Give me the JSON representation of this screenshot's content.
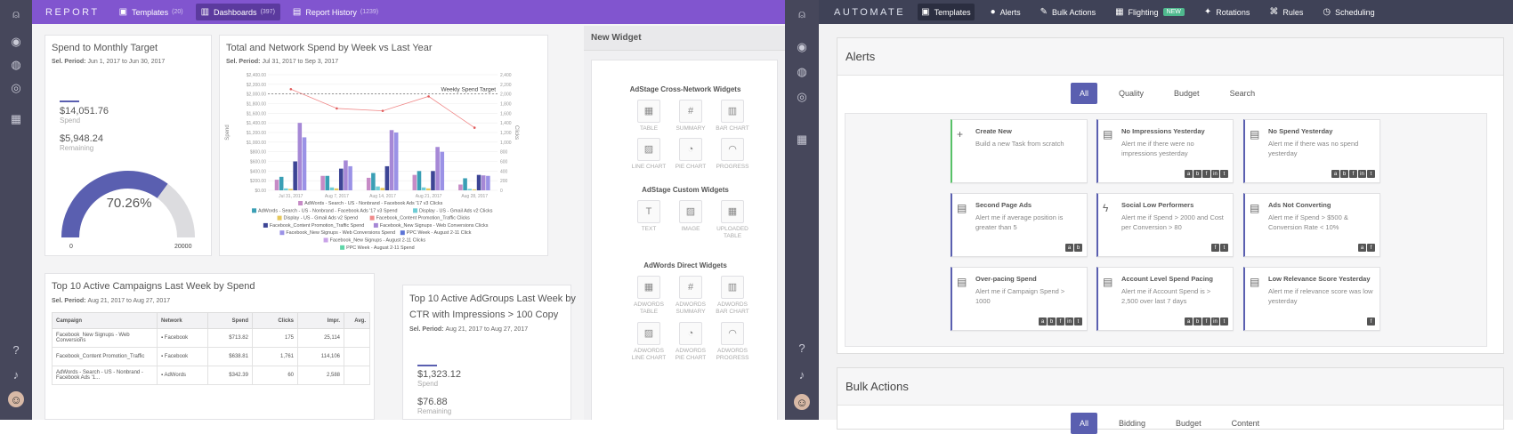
{
  "left": {
    "brand": "REPORT",
    "nav": [
      {
        "label": "Templates",
        "count": "(20)",
        "icon": "▣"
      },
      {
        "label": "Dashboards",
        "count": "(397)",
        "icon": "▥"
      },
      {
        "label": "Report History",
        "count": "(1239)",
        "icon": "▤"
      }
    ],
    "spend_card": {
      "title": "Spend to Monthly Target",
      "sel_label": "Sel. Period:",
      "sel_value": "Jun 1, 2017 to Jun 30, 2017",
      "spend_value": "$14,051.76",
      "spend_label": "Spend",
      "remaining_value": "$5,948.24",
      "remaining_label": "Remaining",
      "percent": "70.26%",
      "percent_value": 70.26,
      "min": "0",
      "max": "20000"
    },
    "network_card": {
      "title": "Total and Network Spend by Week vs Last Year",
      "sel_label": "Sel. Period:",
      "sel_value": "Jul 31, 2017 to Sep 3, 2017"
    },
    "campaigns_card": {
      "title": "Top 10 Active Campaigns Last Week by Spend",
      "sel_label": "Sel. Period:",
      "sel_value": "Aug 21, 2017 to Aug 27, 2017",
      "columns": [
        "Campaign",
        "Network",
        "Spend",
        "Clicks",
        "Impr.",
        "Avg."
      ],
      "rows": [
        {
          "campaign": "Facebook_New Signups - Web Conversions",
          "network": "Facebook",
          "spend": "$713.82",
          "clicks": "175",
          "impr": "25,114",
          "avg": ""
        },
        {
          "campaign": "Facebook_Content Promotion_Traffic",
          "network": "Facebook",
          "spend": "$638.81",
          "clicks": "1,761",
          "impr": "114,106",
          "avg": ""
        },
        {
          "campaign": "AdWords - Search - US - Nonbrand - Facebook Ads '1...",
          "network": "AdWords",
          "spend": "$342.39",
          "clicks": "60",
          "impr": "2,588",
          "avg": ""
        }
      ]
    },
    "adgroups_card": {
      "title_line1": "Top 10 Active AdGroups Last Week by",
      "title_line2": "CTR with Impressions > 100 Copy",
      "sel_label": "Sel. Period:",
      "sel_value": "Aug 21, 2017 to Aug 27, 2017",
      "spend_value": "$1,323.12",
      "spend_label": "Spend",
      "remaining_value": "$76.88",
      "remaining_label": "Remaining"
    },
    "new_widget": {
      "header": "New Widget",
      "sections": [
        {
          "title": "AdStage Cross-Network Widgets",
          "items": [
            {
              "label": "TABLE",
              "icon": "▦"
            },
            {
              "label": "SUMMARY",
              "icon": "#"
            },
            {
              "label": "BAR CHART",
              "icon": "▥"
            },
            {
              "label": "LINE CHART",
              "icon": "▨"
            },
            {
              "label": "PIE CHART",
              "icon": "◔"
            },
            {
              "label": "PROGRESS",
              "icon": "◠"
            }
          ]
        },
        {
          "title": "AdStage Custom Widgets",
          "items": [
            {
              "label": "TEXT",
              "icon": "T"
            },
            {
              "label": "IMAGE",
              "icon": "▨"
            },
            {
              "label": "UPLOADED TABLE",
              "icon": "▦"
            }
          ]
        },
        {
          "title": "AdWords Direct Widgets",
          "items": [
            {
              "label": "ADWORDS TABLE",
              "icon": "▦"
            },
            {
              "label": "ADWORDS SUMMARY",
              "icon": "#"
            },
            {
              "label": "ADWORDS BAR CHART",
              "icon": "▥"
            },
            {
              "label": "ADWORDS LINE CHART",
              "icon": "▨"
            },
            {
              "label": "ADWORDS PIE CHART",
              "icon": "◔"
            },
            {
              "label": "ADWORDS PROGRESS",
              "icon": "◠"
            }
          ]
        }
      ]
    }
  },
  "chart_data": {
    "type": "bar",
    "title": "Total and Network Spend by Week vs Last Year",
    "ylabel": "Spend",
    "ylabel_right": "Clicks",
    "y_ticks": [
      "$0.00",
      "$200.00",
      "$400.00",
      "$600.00",
      "$800.00",
      "$1,000.00",
      "$1,200.00",
      "$1,400.00",
      "$1,600.00",
      "$1,800.00",
      "$2,000.00",
      "$2,200.00",
      "$2,400.00"
    ],
    "y2_ticks": [
      "0",
      "200",
      "400",
      "600",
      "800",
      "1,000",
      "1,200",
      "1,400",
      "1,600",
      "1,800",
      "2,000",
      "2,200",
      "2,400"
    ],
    "ylim": [
      0,
      2400
    ],
    "x_ticks": [
      "Jul 31, 2017",
      "Aug 7, 2017",
      "Aug 14, 2017",
      "Aug 21, 2017",
      "Aug 28, 2017"
    ],
    "target_label": "Weekly Spend Target",
    "target_value": 2000,
    "categories": [
      "Jul 31, 2017",
      "Aug 7, 2017",
      "Aug 14, 2017",
      "Aug 21, 2017",
      "Aug 28, 2017"
    ],
    "series": [
      {
        "name": "AdWords - Search - US - Nonbrand - Facebook Ads '17 v3 Clicks",
        "color": "#c68bc6",
        "values": [
          220,
          300,
          260,
          320,
          120
        ]
      },
      {
        "name": "AdWords - Search - US - Nonbrand - Facebook Ads '17 v3 Spend",
        "color": "#3a9fb5",
        "values": [
          280,
          300,
          360,
          400,
          250
        ]
      },
      {
        "name": "Display - US - Gmail Ads v2 Clicks",
        "color": "#6ecdd6",
        "values": [
          40,
          60,
          80,
          60,
          30
        ]
      },
      {
        "name": "Display - US - Gmail Ads v2 Spend",
        "color": "#e6c85a",
        "values": [
          30,
          40,
          50,
          40,
          20
        ]
      },
      {
        "name": "Facebook_Content Promotion_Traffic Clicks",
        "color": "#f08a8a",
        "values": [
          2100,
          1700,
          1650,
          1950,
          1300
        ]
      },
      {
        "name": "Facebook_Content Promotion_Traffic Spend",
        "color": "#3d4595",
        "values": [
          600,
          450,
          500,
          400,
          320
        ]
      },
      {
        "name": "Facebook_New Signups - Web Conversions Clicks",
        "color": "#a688d6",
        "values": [
          1400,
          620,
          1250,
          900,
          310
        ]
      },
      {
        "name": "Facebook_New Signups - Web Conversions Spend",
        "color": "#9b92e6",
        "values": [
          1100,
          500,
          1200,
          800,
          300
        ]
      },
      {
        "name": "PPC Week - August 2-11 Click",
        "color": "#5c74d6",
        "values": [
          0,
          0,
          0,
          0,
          0
        ]
      },
      {
        "name": "Facebook_New Signups - August 2-11 Clicks",
        "color": "#c9a3e8",
        "values": [
          0,
          0,
          0,
          0,
          0
        ]
      },
      {
        "name": "PPC Week - August 2-11 Spend",
        "color": "#5fd6a8",
        "values": [
          0,
          0,
          0,
          0,
          0
        ]
      }
    ],
    "legend_rows": [
      [
        "AdWords - Search - US - Nonbrand - Facebook Ads '17 v3 Clicks"
      ],
      [
        "AdWords - Search - US - Nonbrand - Facebook Ads '17 v3 Spend",
        "Display - US - Gmail Ads v2 Clicks"
      ],
      [
        "Display - US - Gmail Ads v2 Spend",
        "Facebook_Content Promotion_Traffic Clicks"
      ],
      [
        "Facebook_Content Promotion_Traffic Spend",
        "Facebook_New Signups - Web Conversions Clicks"
      ],
      [
        "Facebook_New Signups - Web Conversions Spend",
        "PPC Week - August 2-11 Click"
      ],
      [
        "Facebook_New Signups - August 2-11 Clicks"
      ],
      [
        "PPC Week - August 2-11 Spend"
      ]
    ]
  },
  "right": {
    "brand": "AUTOMATE",
    "nav": [
      {
        "label": "Templates",
        "icon": "▣"
      },
      {
        "label": "Alerts",
        "icon": "●"
      },
      {
        "label": "Bulk Actions",
        "icon": "✎"
      },
      {
        "label": "Flighting",
        "icon": "▦",
        "badge": "NEW"
      },
      {
        "label": "Rotations",
        "icon": "✦"
      },
      {
        "label": "Rules",
        "icon": "⌘"
      },
      {
        "label": "Scheduling",
        "icon": "◷"
      }
    ],
    "alerts": {
      "title": "Alerts",
      "tabs": [
        "All",
        "Quality",
        "Budget",
        "Search"
      ],
      "cards": [
        {
          "title": "Create New",
          "desc": "Build a new Task from scratch",
          "icon": "+",
          "channels": []
        },
        {
          "title": "No Impressions Yesterday",
          "desc": "Alert me if there were no impressions yesterday",
          "icon": "▤",
          "channels": [
            "a",
            "b",
            "f",
            "in",
            "t"
          ]
        },
        {
          "title": "No Spend Yesterday",
          "desc": "Alert me if there was no spend yesterday",
          "icon": "▤",
          "channels": [
            "a",
            "b",
            "f",
            "in",
            "t"
          ]
        },
        {
          "title": "Second Page Ads",
          "desc": "Alert me if average position is greater than 5",
          "icon": "▤",
          "channels": [
            "a",
            "b"
          ]
        },
        {
          "title": "Social Low Performers",
          "desc": "Alert me if Spend > 2000 and Cost per Conversion > 80",
          "icon": "ϟ",
          "channels": [
            "f",
            "t"
          ]
        },
        {
          "title": "Ads Not Converting",
          "desc": "Alert me if Spend > $500 & Conversion Rate < 10%",
          "icon": "▤",
          "channels": [
            "a",
            "f"
          ]
        },
        {
          "title": "Over-pacing Spend",
          "desc": "Alert me if Campaign Spend > 1000",
          "icon": "▤",
          "channels": [
            "a",
            "b",
            "f",
            "in",
            "t"
          ]
        },
        {
          "title": "Account Level Spend Pacing",
          "desc": "Alert me if Account Spend is > 2,500 over last 7 days",
          "icon": "▤",
          "channels": [
            "a",
            "b",
            "f",
            "in",
            "t"
          ]
        },
        {
          "title": "Low Relevance Score Yesterday",
          "desc": "Alert me if relevance score was low yesterday",
          "icon": "▤",
          "channels": [
            "f"
          ]
        }
      ]
    },
    "bulk": {
      "title": "Bulk Actions",
      "tabs": [
        "All",
        "Bidding",
        "Budget",
        "Content"
      ]
    }
  }
}
